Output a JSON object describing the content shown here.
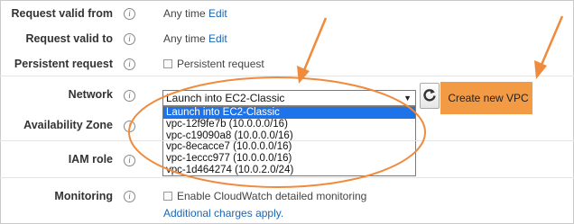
{
  "request_valid_from": {
    "label": "Request valid from",
    "value": "Any time",
    "link": "Edit"
  },
  "request_valid_to": {
    "label": "Request valid to",
    "value": "Any time",
    "link": "Edit"
  },
  "persistent_request": {
    "label": "Persistent request",
    "checkbox_label": "Persistent request",
    "checked": false
  },
  "network": {
    "label": "Network",
    "selected": "Launch into EC2-Classic",
    "options": [
      "Launch into EC2-Classic",
      "vpc-12f9fe7b (10.0.0.0/16)",
      "vpc-c19090a8 (10.0.0.0/16)",
      "vpc-8ecacce7 (10.0.0.0/16)",
      "vpc-1eccc977 (10.0.0.0/16)",
      "vpc-1d464274 (10.0.2.0/24)"
    ],
    "create_button": "Create new VPC"
  },
  "availability_zone": {
    "label": "Availability Zone"
  },
  "iam_role": {
    "label": "IAM role"
  },
  "monitoring": {
    "label": "Monitoring",
    "checkbox_label": "Enable CloudWatch detailed monitoring",
    "checked": false,
    "note": "Additional charges apply."
  },
  "info_icon_glyph": "i",
  "colors": {
    "annotation": "#f08a3c",
    "button": "#f39a45",
    "selection": "#1e73e8",
    "link": "#1a66b3"
  }
}
